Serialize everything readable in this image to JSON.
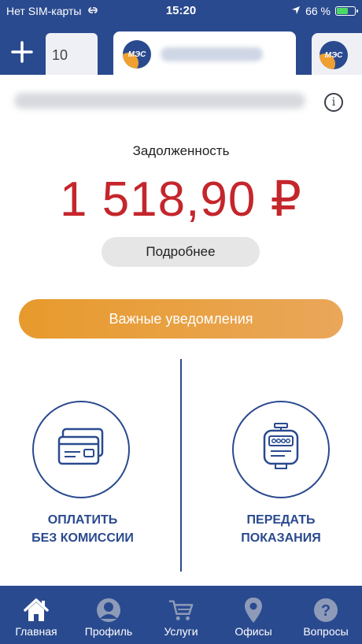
{
  "statusbar": {
    "carrier": "Нет SIM-карты",
    "time": "15:20",
    "battery": "66 %",
    "battery_level": 0.66
  },
  "tabs": {
    "add_icon": "plus-icon",
    "prev_partial_text": "10",
    "active_logo_text": "МЭС",
    "next_logo_text": "МЭС"
  },
  "account": {
    "info_icon": "info-icon"
  },
  "debt": {
    "label": "Задолженность",
    "amount": "1 518,90 ₽",
    "details_button": "Подробнее"
  },
  "notifications": {
    "button_label": "Важные уведомления"
  },
  "actions": {
    "pay": {
      "line1": "ОПЛАТИТЬ",
      "line2": "БЕЗ КОМИССИИ",
      "icon": "credit-card-icon"
    },
    "meter": {
      "line1": "ПЕРЕДАТЬ",
      "line2": "ПОКАЗАНИЯ",
      "icon": "meter-icon"
    }
  },
  "bottom_nav": {
    "items": [
      {
        "label": "Главная",
        "icon": "home-icon",
        "active": true
      },
      {
        "label": "Профиль",
        "icon": "profile-icon",
        "active": false
      },
      {
        "label": "Услуги",
        "icon": "cart-icon",
        "active": false
      },
      {
        "label": "Офисы",
        "icon": "location-pin-icon",
        "active": false
      },
      {
        "label": "Вопросы",
        "icon": "question-icon",
        "active": false
      }
    ]
  },
  "colors": {
    "primary": "#2a4a8f",
    "debt": "#c4262c",
    "accent": "#e79a2c",
    "battery": "#4cd964"
  }
}
